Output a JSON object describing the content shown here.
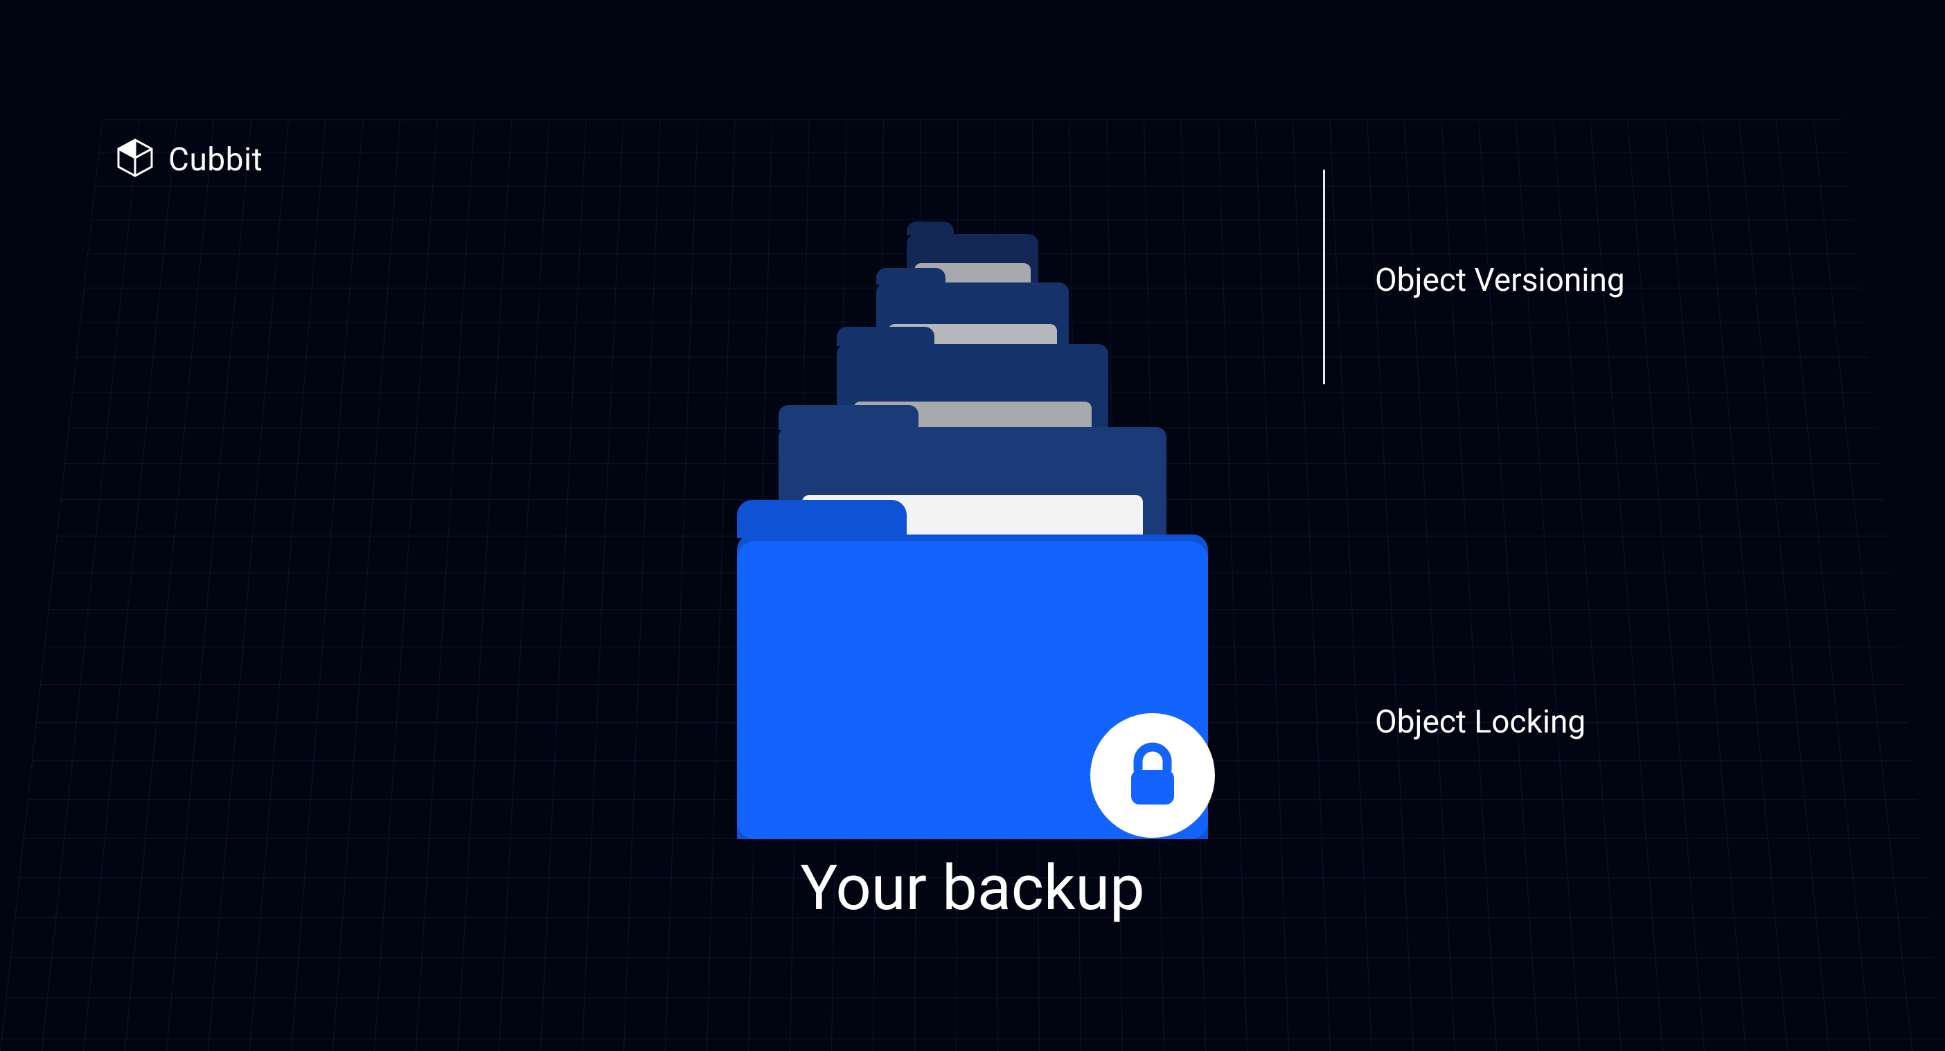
{
  "brand": {
    "name": "Cubbit"
  },
  "main_label": "Your backup",
  "callouts": {
    "versioning": "Object Versioning",
    "locking": "Object Locking"
  },
  "colors": {
    "bg": "#010511",
    "grid": "#1c306e",
    "folder_main": "#1363ff",
    "folder_dark": "#16326a",
    "folder_darker": "#132754",
    "paper_light": "#f3f3f3",
    "paper_gray": "#a7a9ad",
    "white": "#ffffff"
  }
}
